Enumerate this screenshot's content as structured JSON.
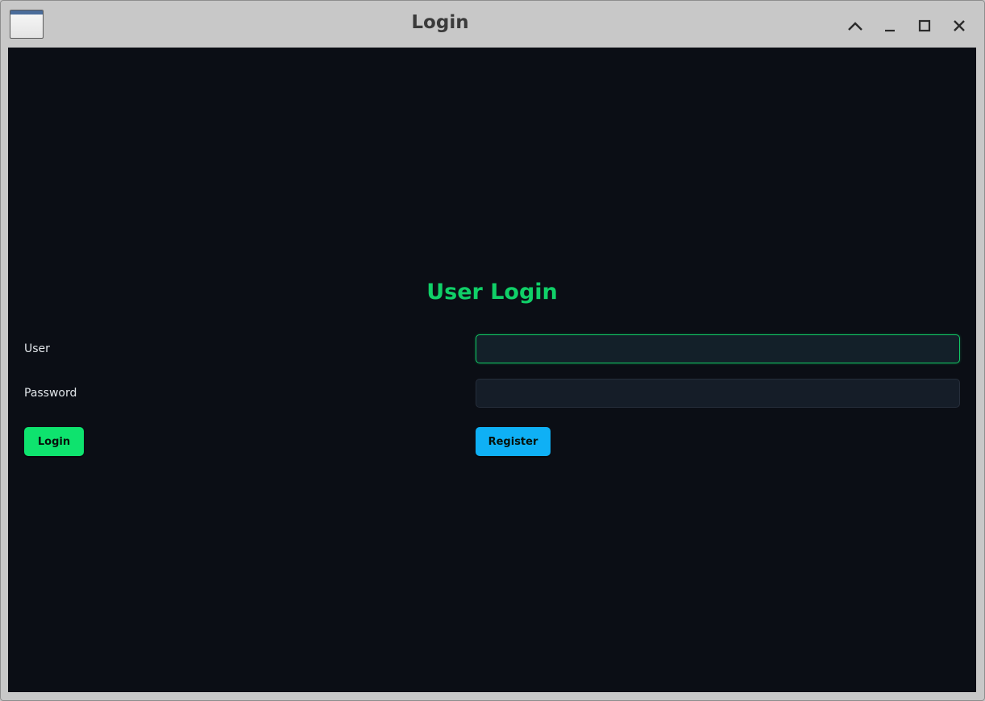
{
  "window": {
    "title": "Login",
    "controls": {
      "shade": "chevron-up-icon",
      "minimize": "minimize-icon",
      "maximize": "maximize-icon",
      "close": "close-icon"
    }
  },
  "form": {
    "heading": "User Login",
    "user_label": "User",
    "user_value": "",
    "password_label": "Password",
    "password_value": "",
    "login_label": "Login",
    "register_label": "Register"
  },
  "colors": {
    "background": "#0b0e15",
    "heading": "#10d068",
    "login_button": "#0ee36e",
    "register_button": "#0fb0f5",
    "focused_border": "#12c865"
  }
}
